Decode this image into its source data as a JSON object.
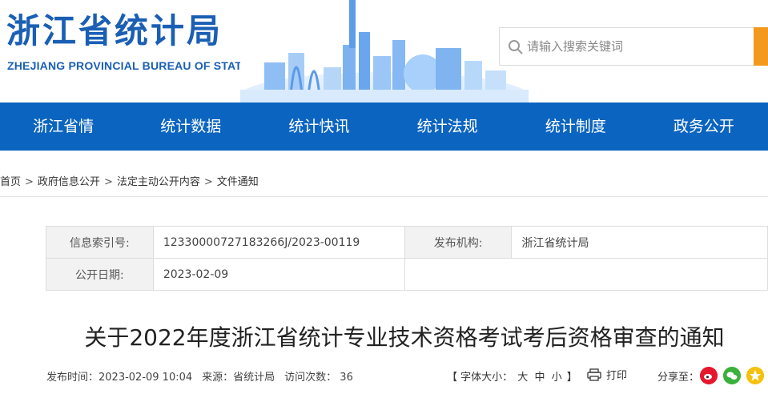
{
  "header": {
    "logo_cn": "浙江省统计局",
    "logo_en": "ZHEJIANG PROVINCIAL BUREAU OF STATISTICS"
  },
  "search": {
    "placeholder": "请输入搜索关键词"
  },
  "nav": {
    "items": [
      "浙江省情",
      "统计数据",
      "统计快讯",
      "统计法规",
      "统计制度",
      "政务公开"
    ]
  },
  "breadcrumb": [
    "首页",
    "政府信息公开",
    "法定主动公开内容",
    "文件通知"
  ],
  "info": {
    "index_label": "信息索引号:",
    "index_value": "12330000727183266J/2023-00119",
    "publisher_label": "发布机构:",
    "publisher_value": "浙江省统计局",
    "date_label": "公开日期:",
    "date_value": "2023-02-09"
  },
  "article": {
    "title": "关于2022年度浙江省统计专业技术资格考试考后资格审查的通知",
    "publish_time": "发布时间：2023-02-09 10:04",
    "source": "来源：省统计局",
    "visits": "访问次数：  36",
    "fontsize_label": "【 字体大小：",
    "fontsize_large": "大",
    "fontsize_medium": "中",
    "fontsize_small": "小",
    "fontsize_close": "】",
    "print_label": "打印",
    "share_label": "分享至："
  },
  "colors": {
    "brand_blue": "#0b64c0",
    "search_button": "#f39a1e"
  }
}
